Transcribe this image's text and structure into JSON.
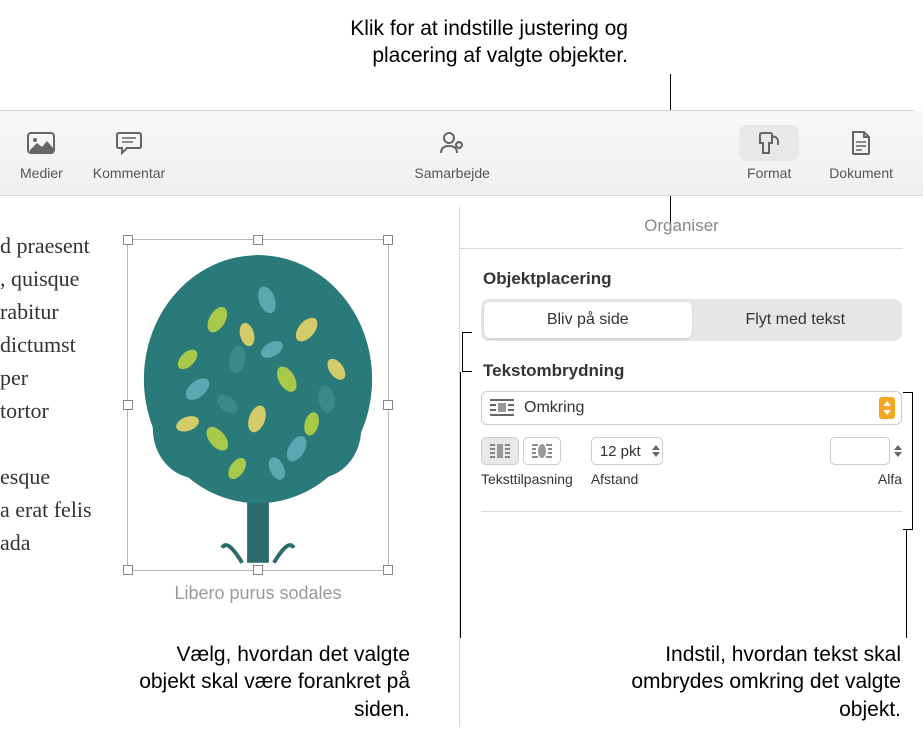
{
  "callouts": {
    "top": "Klik for at indstille justering og placering af valgte objekter.",
    "bottom_left": "Vælg, hvordan det valgte objekt skal være forankret på siden.",
    "bottom_right": "Indstil, hvordan tekst skal ombrydes omkring det valgte objekt."
  },
  "toolbar": {
    "medier": "Medier",
    "kommentar": "Kommentar",
    "samarbejde": "Samarbejde",
    "format": "Format",
    "dokument": "Dokument"
  },
  "tabs": {
    "organiser": "Organiser"
  },
  "sidebar": {
    "objektplacering": "Objektplacering",
    "stay_on_page": "Bliv på side",
    "move_with_text": "Flyt med tekst",
    "tekstombrydning": "Tekstombrydning",
    "wrap_mode": "Omkring",
    "teksttilpasning": "Teksttilpasning",
    "afstand": "Afstand",
    "afstand_value": "12 pkt",
    "alfa": "Alfa"
  },
  "document": {
    "lines": [
      "d praesent",
      ", quisque",
      "rabitur",
      "dictumst",
      "per",
      "tortor",
      "",
      "esque",
      "a erat felis",
      "ada"
    ],
    "caption": "Libero purus sodales"
  }
}
